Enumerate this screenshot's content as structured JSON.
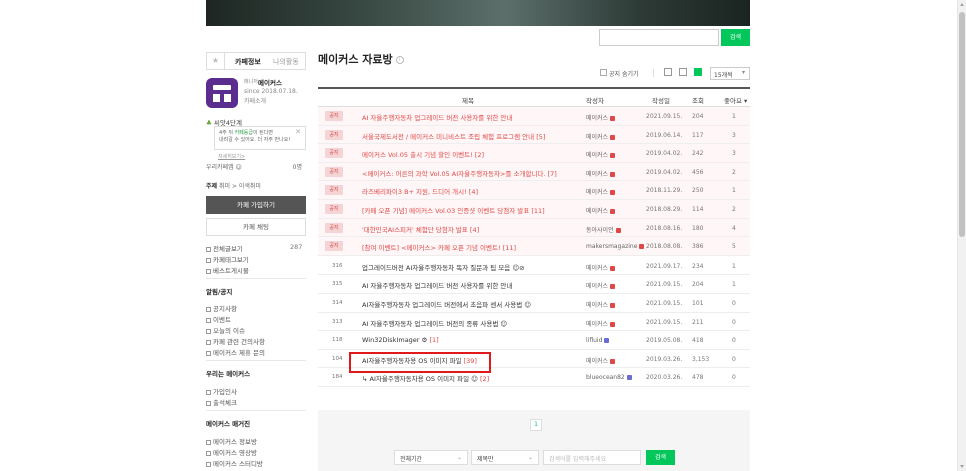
{
  "header": {
    "search_button": "검색"
  },
  "sidebar": {
    "tab_cafe_info": "카페정보",
    "tab_my_activity": "나의활동",
    "manager_role": "매니저",
    "manager_name": "메이커스",
    "since": "since 2018.07.18.",
    "cafe_intro": "카페소개",
    "level": "씨앗4단계",
    "tip_line1_pre": "4주 뒤 ",
    "tip_line1_grn": "카페등급",
    "tip_line1_post": "이 된다면",
    "tip_line2": "내려갈 수 있어요. 더 자주 만나요!",
    "tip_more": "자세히보기>",
    "member_label": "우리카페앱 ☺",
    "member_count": "0명",
    "theme_label": "주제",
    "theme_value": "취미 > 이색취미",
    "join_button": "카페 가입하기",
    "chat_button": "카페 채팅",
    "links": [
      {
        "label": "전체글보기",
        "count": "287"
      },
      {
        "label": "카페태그보기"
      },
      {
        "label": "베스트게시물"
      }
    ],
    "section_notice": "알림/공지",
    "notice_links": [
      "공지사항",
      "이벤트",
      "오늘의 이슈",
      "카페 관련 건의사항",
      "메이커스 제휴 문의"
    ],
    "section_welcome": "우리는 메이커스",
    "welcome_links": [
      "가입인사",
      "출석체크"
    ],
    "section_magazine": "메이커스 매거진",
    "magazine_links": [
      "메이커스 정보방",
      "메이커스 영상방",
      "메이커스 스터디방"
    ]
  },
  "main": {
    "title": "메이커스 자료방",
    "hide_notice": "공지 숨기기",
    "per_page": "15개씩",
    "columns": {
      "title": "제목",
      "author": "작성자",
      "date": "작성일",
      "views": "조회",
      "likes": "좋아요"
    },
    "notices": [
      {
        "badge": "공지",
        "title": "AI 자율주행자동차 업그레이드 버전 사용자를 위한 안내",
        "comments": "",
        "author": "메이커스",
        "date": "2021.09.15.",
        "views": "204",
        "likes": "1"
      },
      {
        "badge": "공지",
        "title": "서울국제도서전 / 메이커스 미니비스트 조립 체험 프로그램 안내",
        "comments": "[5]",
        "author": "메이커스",
        "date": "2019.06.14.",
        "views": "117",
        "likes": "3"
      },
      {
        "badge": "공지",
        "title": "메이커스 Vol.05 출시 기념 할인 이벤트!",
        "comments": "[2]",
        "author": "메이커스",
        "date": "2019.04.02.",
        "views": "242",
        "likes": "3"
      },
      {
        "badge": "공지",
        "title": "<메이커스: 어른의 과학 Vol.05 AI자율주행자동차>를 소개합니다.",
        "comments": "[7]",
        "author": "메이커스",
        "date": "2019.04.02.",
        "views": "456",
        "likes": "2"
      },
      {
        "badge": "공지",
        "title": "라즈베리파이3 B+ 지원, 드디어 개시!",
        "comments": "[4]",
        "author": "메이커스",
        "date": "2018.11.29.",
        "views": "250",
        "likes": "1"
      },
      {
        "badge": "공지",
        "title": "[카페 오픈 기념] 메이커스 Vol.03 인증샷 이벤트 당첨자 발표",
        "comments": "[11]",
        "author": "메이커스",
        "date": "2018.08.29.",
        "views": "114",
        "likes": "2"
      },
      {
        "badge": "공지",
        "title": "'대한민국AI스피커' 체험단 당첨자 발표",
        "comments": "[4]",
        "author": "동아사이언",
        "date": "2018.08.16.",
        "views": "180",
        "likes": "4"
      },
      {
        "badge": "공지",
        "title": "[참여 이벤트] <메이커스> 카페 오픈 기념 이벤트!",
        "comments": "[11]",
        "author": "makersmagazine",
        "date": "2018.08.08.",
        "views": "386",
        "likes": "5"
      }
    ],
    "posts": [
      {
        "num": "316",
        "title": "업그레이드버전 AI자율주행자동차 독자 질문과 팁 모음 ☺⊘",
        "comments": "",
        "author": "메이커스",
        "date": "2021.09.17.",
        "views": "234",
        "likes": "1"
      },
      {
        "num": "315",
        "title": "AI 자율주행자동차 업그레이드 버전 사용자를 위한 안내",
        "comments": "",
        "author": "메이커스",
        "date": "2021.09.15.",
        "views": "204",
        "likes": "1"
      },
      {
        "num": "314",
        "title": "AI자율주행자동차 업그레이드 버전에서 초음파 센서 사용법 ☺",
        "comments": "",
        "author": "메이커스",
        "date": "2021.09.15.",
        "views": "101",
        "likes": "0"
      },
      {
        "num": "313",
        "title": "AI 자율주행자동차 업그레이드 버전의 종류 사용법 ☺",
        "comments": "",
        "author": "메이커스",
        "date": "2021.09.15.",
        "views": "211",
        "likes": "0"
      },
      {
        "num": "118",
        "title": "Win32DiskImager ⚙",
        "comments": "[1]",
        "author": "lifluid",
        "date": "2019.05.08.",
        "views": "418",
        "likes": "0"
      },
      {
        "num": "104",
        "title": "AI자율주행자동차용 OS 이미지 파일",
        "comments": "[39]",
        "author": "메이커스",
        "date": "2019.03.26.",
        "views": "3,153",
        "likes": "0"
      },
      {
        "num": "184",
        "title": "↳ AI자율주행자동차용 OS 이미지 파일 ☺",
        "comments": "[2]",
        "author": "blueocean82",
        "date": "2020.03.26.",
        "views": "478",
        "likes": "0"
      }
    ],
    "page": "1",
    "search": {
      "period": "전체기간",
      "scope": "제목만",
      "placeholder": "검색어를 입력해주세요",
      "button": "검색"
    }
  },
  "colors": {
    "accent_green": "#03c75a",
    "notice_red": "#e04848",
    "highlight_box": "#e0191a"
  }
}
